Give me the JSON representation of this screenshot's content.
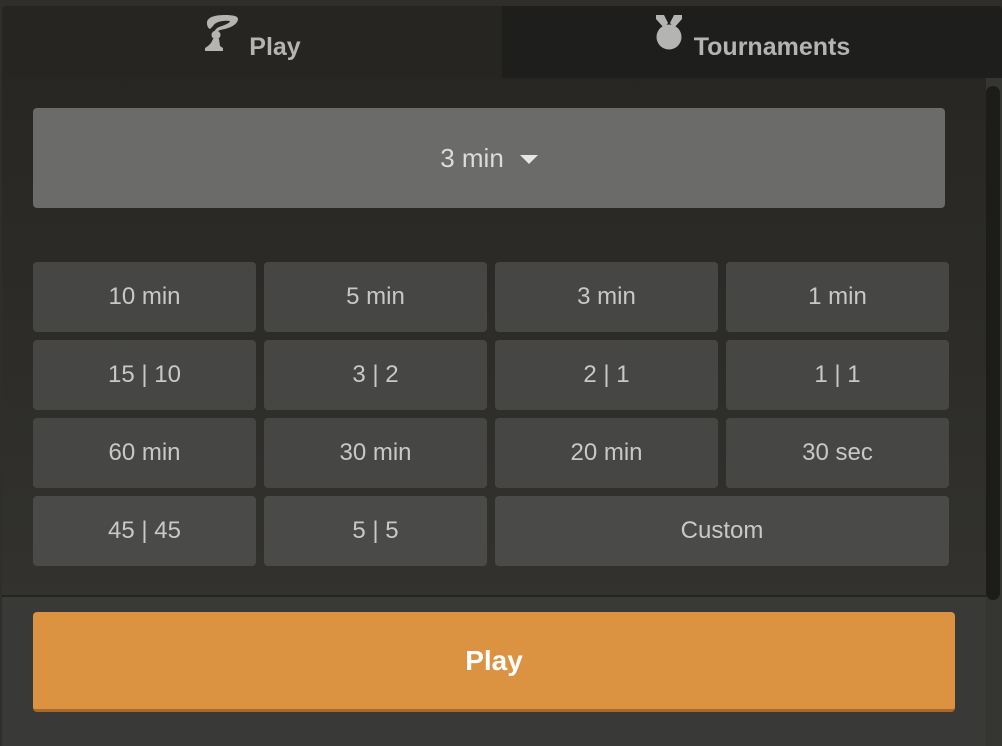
{
  "tabs": [
    {
      "label": "Play",
      "icon": "pawn-hand-icon",
      "active": true
    },
    {
      "label": "Tournaments",
      "icon": "medal-icon",
      "active": false
    }
  ],
  "time_selector": {
    "selected": "3 min",
    "icon": "caret-down-icon"
  },
  "time_controls": [
    [
      "10 min",
      "5 min",
      "3 min",
      "1 min"
    ],
    [
      "15 | 10",
      "3 | 2",
      "2 | 1",
      "1 | 1"
    ],
    [
      "60 min",
      "30 min",
      "20 min",
      "30 sec"
    ],
    [
      "45 | 45",
      "5 | 5",
      "Custom"
    ]
  ],
  "play_button": {
    "label": "Play",
    "color": "#db9341"
  },
  "colors": {
    "accent": "#db9341",
    "selector_bg": "#6b6b69",
    "tile_bg": "#464644"
  }
}
